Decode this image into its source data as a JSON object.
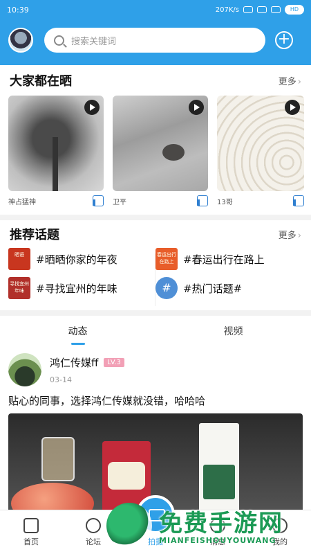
{
  "status": {
    "time": "10:39",
    "net_speed": "207K/s",
    "battery": "HD"
  },
  "header": {
    "search_placeholder": "搜索关键词"
  },
  "everyone": {
    "title": "大家都在晒",
    "more": "更多",
    "items": [
      {
        "author": "神占猛神"
      },
      {
        "author": "卫平"
      },
      {
        "author": "13哥"
      }
    ]
  },
  "topics": {
    "title": "推荐话题",
    "more": "更多",
    "items": [
      {
        "icon_text": "晒语",
        "label": "#晒晒你家的年夜"
      },
      {
        "icon_text": "春运出行在路上",
        "label": "#春运出行在路上"
      },
      {
        "icon_text": "寻找宜州年味",
        "label": "#寻找宜州的年味"
      },
      {
        "icon_text": "#",
        "label": "#热门话题#"
      }
    ]
  },
  "feed": {
    "tabs": [
      "动态",
      "视频"
    ],
    "post": {
      "user": "鸿仁传媒ff",
      "level": "LV.3",
      "date": "03-14",
      "text": "贴心的同事，选择鸿仁传媒就没错，哈哈哈"
    }
  },
  "bottom_nav": {
    "items": [
      "首页",
      "论坛",
      "拍摄",
      "消息",
      "我的"
    ]
  },
  "watermark": {
    "cn": "免费手游网",
    "en": "MIANFEISHOUYOUWANG"
  },
  "colors": {
    "brand": "#2fa0e8",
    "level_badge": "#f2a0b6",
    "watermark": "#1b9a55"
  }
}
